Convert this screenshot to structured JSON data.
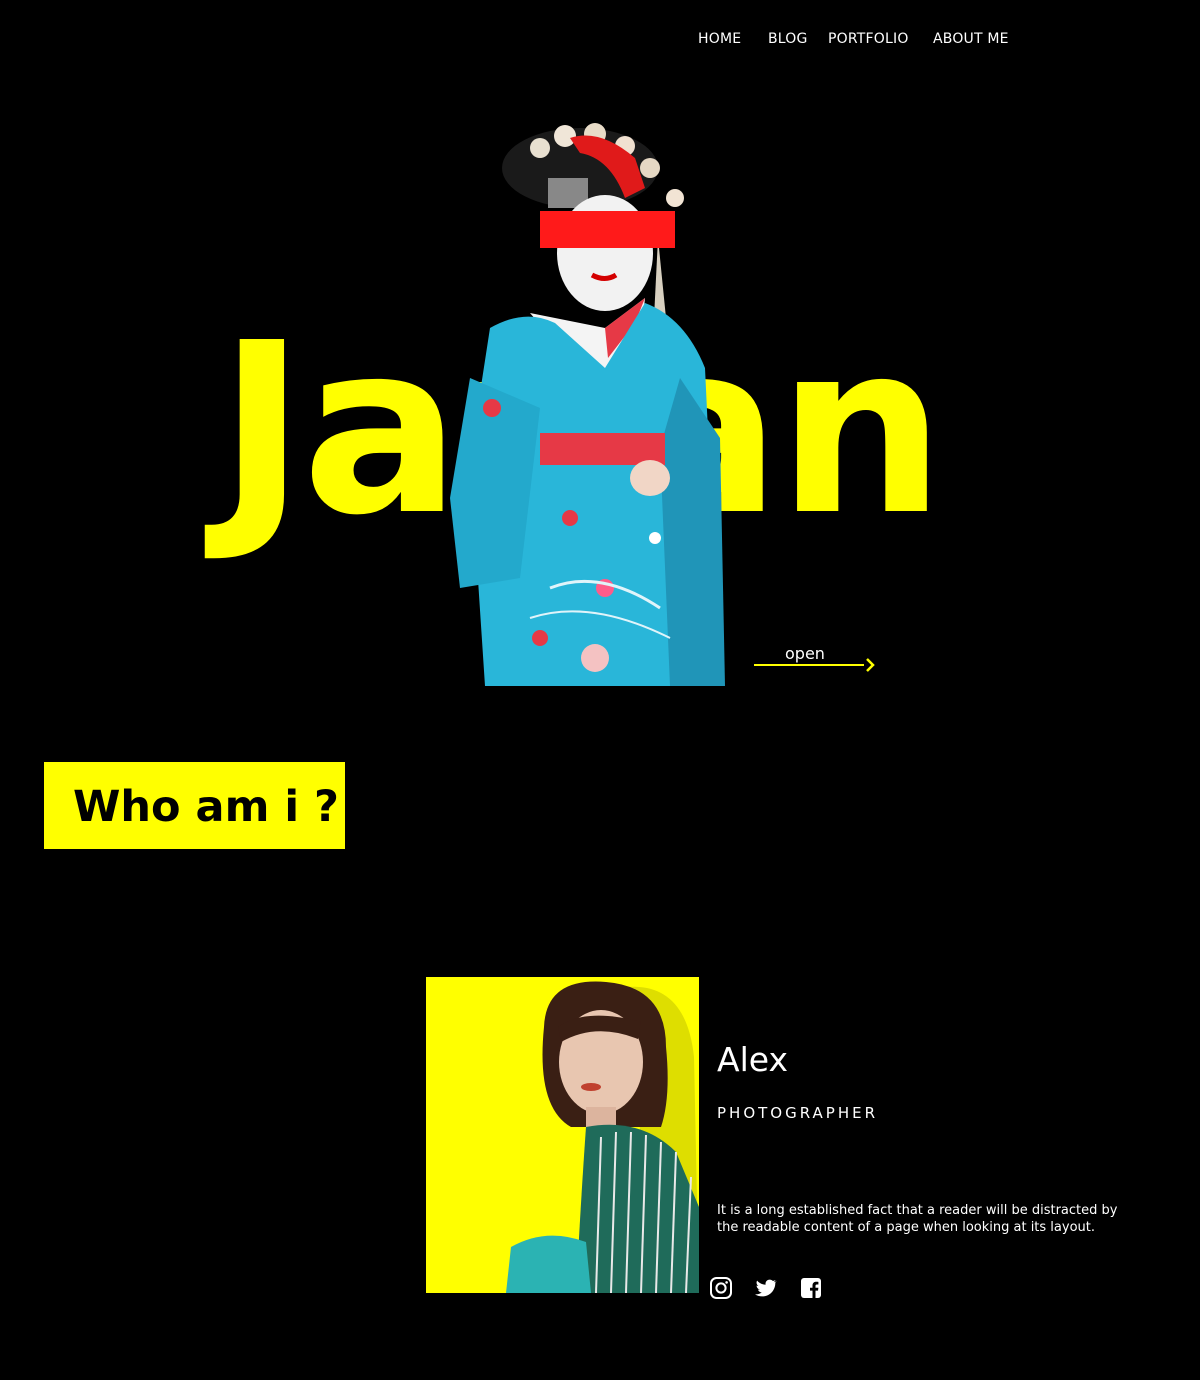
{
  "nav": {
    "items": [
      {
        "label": "HOME"
      },
      {
        "label": "BLOG"
      },
      {
        "label": "PORTFOLIO"
      },
      {
        "label": "ABOUT ME"
      }
    ]
  },
  "hero": {
    "title": "Japan",
    "open_label": "open"
  },
  "about": {
    "heading": "Who am i ?",
    "name": "Alex",
    "role": "PHOTOGRAPHER",
    "bio": "It is a long established fact that a reader will be distracted by the readable content of a page when looking at its layout."
  },
  "social": {
    "icons": [
      "instagram-icon",
      "twitter-icon",
      "facebook-icon"
    ]
  },
  "colors": {
    "background": "#000000",
    "accent": "#ffff00",
    "kimono": "#29b6d9",
    "face_band": "#ff1a1a"
  }
}
